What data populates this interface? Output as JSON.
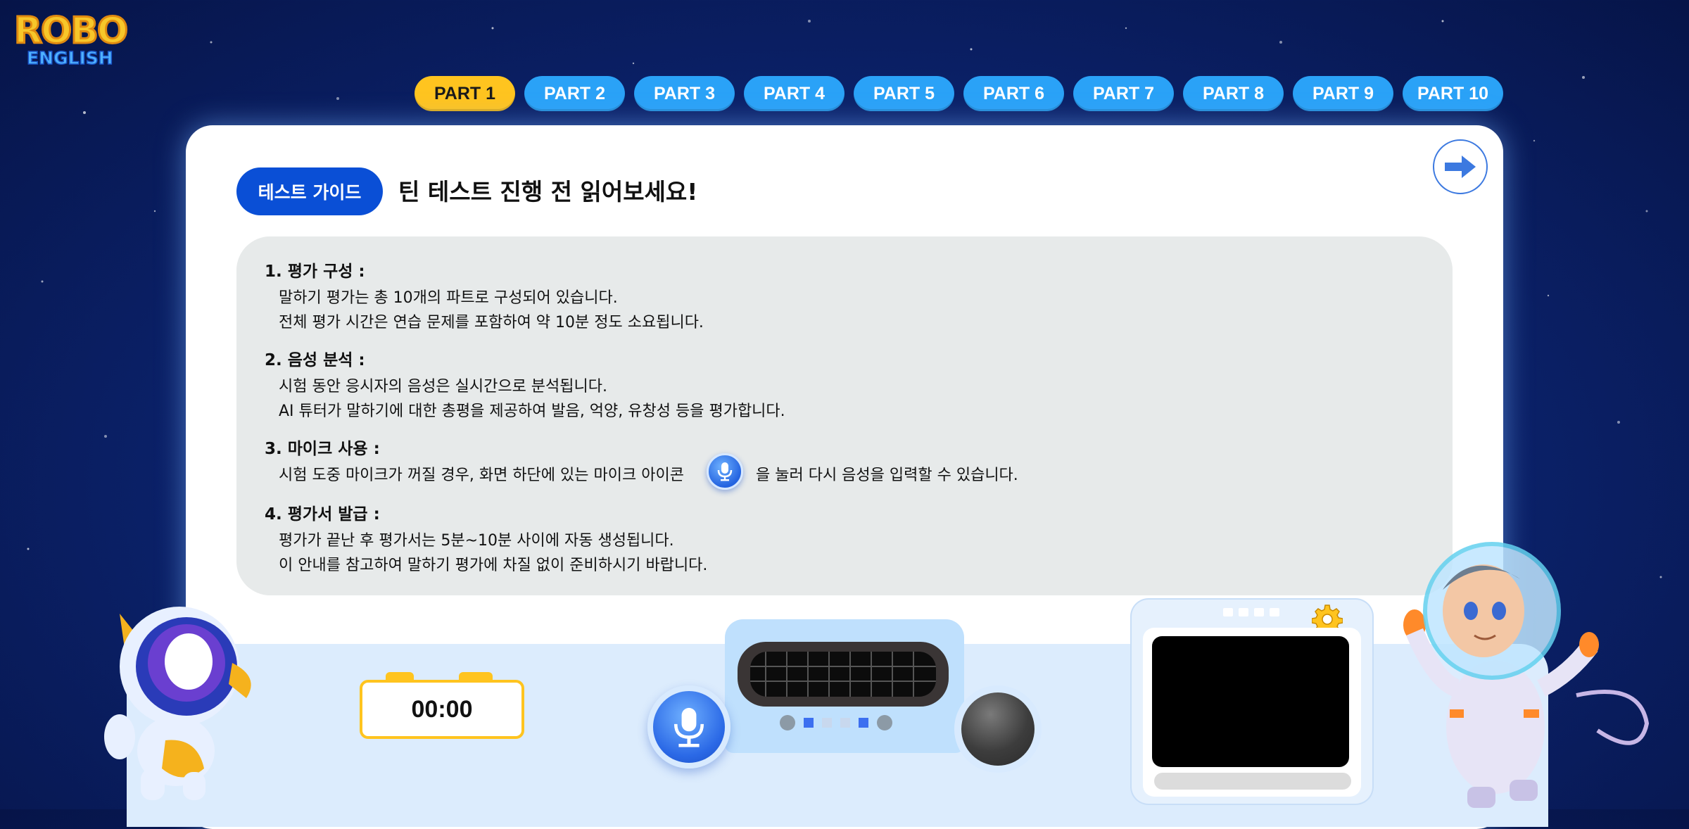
{
  "logo": {
    "line1": "ROBO",
    "line2": "ENGLISH"
  },
  "tabs": [
    {
      "label": "PART 1",
      "active": true
    },
    {
      "label": "PART 2"
    },
    {
      "label": "PART 3"
    },
    {
      "label": "PART 4"
    },
    {
      "label": "PART 5"
    },
    {
      "label": "PART 6"
    },
    {
      "label": "PART 7"
    },
    {
      "label": "PART 8"
    },
    {
      "label": "PART 9"
    },
    {
      "label": "PART 10"
    }
  ],
  "guide": {
    "pill": "테스트 가이드",
    "title": "틴 테스트 진행 전 읽어보세요!"
  },
  "sections": [
    {
      "heading": "1. 평가 구성 :",
      "lines": [
        "말하기 평가는 총 10개의 파트로 구성되어 있습니다.",
        "전체 평가 시간은 연습 문제를 포함하여 약 10분 정도 소요됩니다."
      ]
    },
    {
      "heading": "2. 음성 분석 :",
      "lines": [
        "시험 동안 응시자의 음성은 실시간으로 분석됩니다.",
        "AI 튜터가 말하기에 대한 총평을 제공하여 발음, 억양, 유창성 등을 평가합니다."
      ]
    },
    {
      "heading": "3. 마이크 사용 :",
      "line_before_icon": "시험 도중 마이크가 꺼질 경우, 화면 하단에 있는 마이크 아이콘",
      "line_after_icon": "을 눌러 다시 음성을 입력할 수 있습니다."
    },
    {
      "heading": "4. 평가서 발급 :",
      "lines": [
        "평가가 끝난 후 평가서는 5분~10분 사이에 자동 생성됩니다.",
        "이 안내를 참고하여 말하기 평가에 차질 없이 준비하시기 바랍니다."
      ]
    }
  ],
  "timer": {
    "value": "00:00"
  },
  "colors": {
    "accent_yellow": "#ffc41f",
    "tab_blue": "#2aa2f7",
    "primary_blue": "#0a4fd6"
  }
}
